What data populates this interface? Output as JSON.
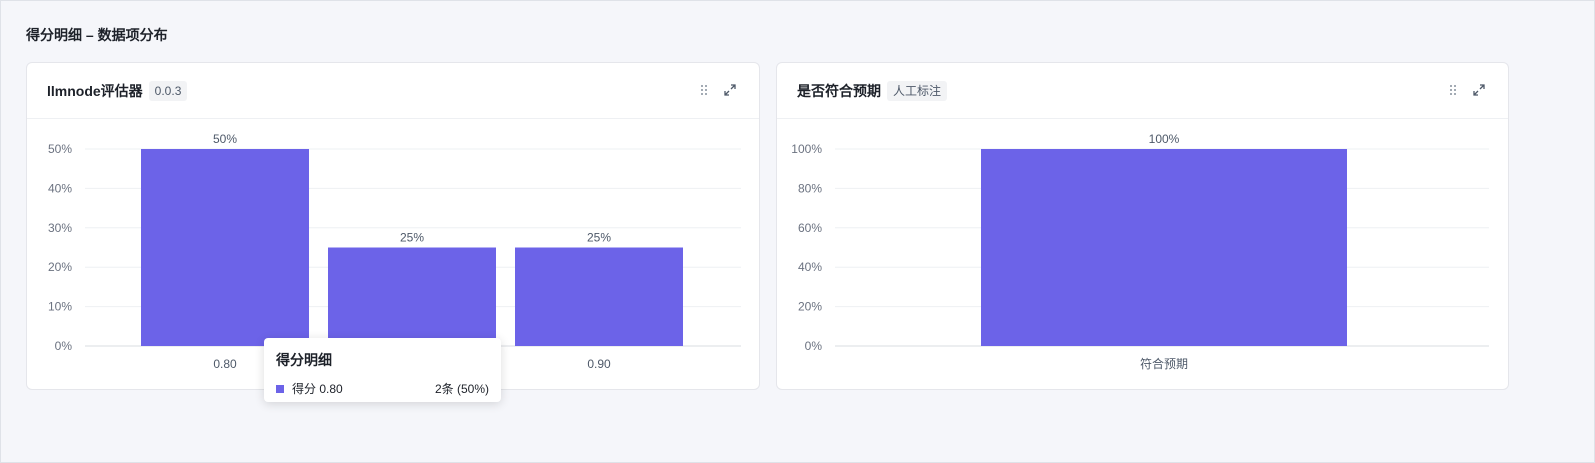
{
  "section_title": "得分明细 – 数据项分布",
  "bar_color": "#6c63e8",
  "cards": [
    {
      "title": "llmnode评估器",
      "tag": "0.0.3",
      "icons": [
        "drag-handle-icon",
        "expand-icon"
      ]
    },
    {
      "title": "是否符合预期",
      "tag": "人工标注",
      "icons": [
        "drag-handle-icon",
        "expand-icon"
      ]
    }
  ],
  "tooltip": {
    "title": "得分明细",
    "label": "得分 0.80",
    "value": "2条 (50%)"
  },
  "chart_data": [
    {
      "type": "bar",
      "categories": [
        "0.80",
        "0.50",
        "0.90"
      ],
      "values": [
        50,
        25,
        25
      ],
      "data_labels": [
        "50%",
        "25%",
        "25%"
      ],
      "ylim": [
        0,
        50
      ],
      "yticks": [
        "0%",
        "10%",
        "20%",
        "30%",
        "40%",
        "50%"
      ],
      "grid": true
    },
    {
      "type": "bar",
      "categories": [
        "符合预期"
      ],
      "values": [
        100
      ],
      "data_labels": [
        "100%"
      ],
      "ylim": [
        0,
        100
      ],
      "yticks": [
        "0%",
        "20%",
        "40%",
        "60%",
        "80%",
        "100%"
      ],
      "grid": true
    }
  ]
}
